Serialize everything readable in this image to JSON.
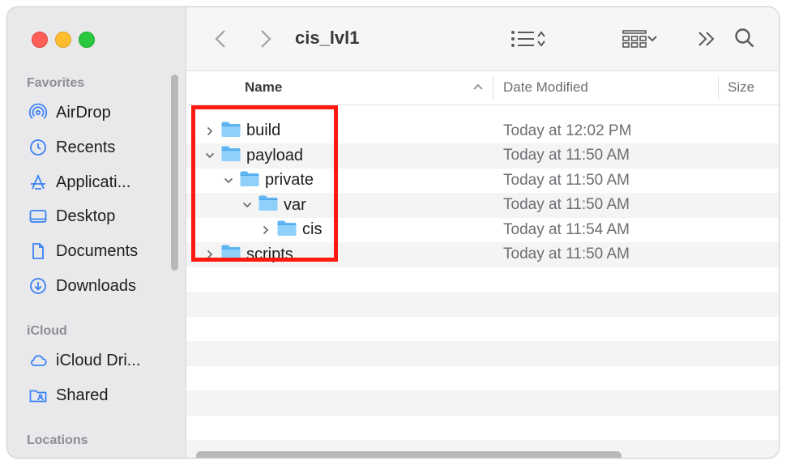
{
  "window": {
    "title": "cis_lvl1"
  },
  "sidebar": {
    "sections": [
      {
        "label": "Favorites"
      },
      {
        "label": "iCloud"
      },
      {
        "label": "Locations"
      }
    ],
    "items": [
      {
        "label": "AirDrop",
        "icon": "airdrop-icon"
      },
      {
        "label": "Recents",
        "icon": "clock-icon"
      },
      {
        "label": "Applicati...",
        "icon": "applications-icon"
      },
      {
        "label": "Desktop",
        "icon": "desktop-icon"
      },
      {
        "label": "Documents",
        "icon": "document-icon"
      },
      {
        "label": "Downloads",
        "icon": "download-icon"
      },
      {
        "label": "iCloud Dri...",
        "icon": "cloud-icon"
      },
      {
        "label": "Shared",
        "icon": "shared-folder-icon"
      }
    ]
  },
  "columns": {
    "name": "Name",
    "date": "Date Modified",
    "size": "Size"
  },
  "rows": [
    {
      "name": "build",
      "date": "Today at 12:02 PM",
      "depth": 0,
      "expanded": false
    },
    {
      "name": "payload",
      "date": "Today at 11:50 AM",
      "depth": 0,
      "expanded": true
    },
    {
      "name": "private",
      "date": "Today at 11:50 AM",
      "depth": 1,
      "expanded": true
    },
    {
      "name": "var",
      "date": "Today at 11:50 AM",
      "depth": 2,
      "expanded": true
    },
    {
      "name": "cis",
      "date": "Today at 11:54 AM",
      "depth": 3,
      "expanded": false
    },
    {
      "name": "scripts",
      "date": "Today at 11:50 AM",
      "depth": 0,
      "expanded": false
    }
  ],
  "colors": {
    "accent": "#3b82f6",
    "folder": "#5fb6f3",
    "highlight": "#ff1a0f"
  }
}
